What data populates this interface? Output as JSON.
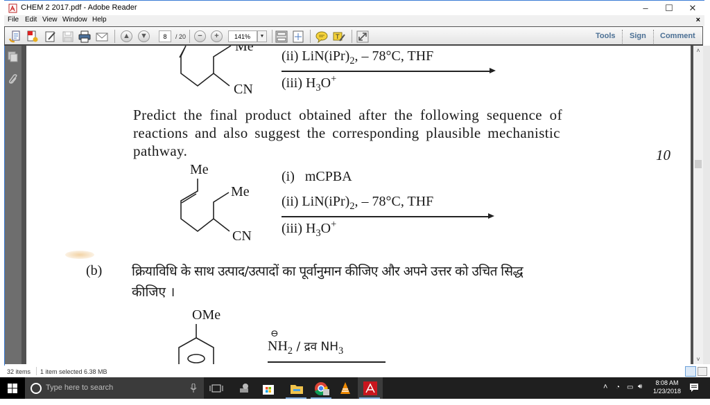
{
  "window": {
    "title": "CHEM 2 2017.pdf - Adobe Reader",
    "controls": {
      "minimize": "–",
      "maximize": "☐",
      "close": "✕"
    }
  },
  "menubar": {
    "items": [
      "File",
      "Edit",
      "View",
      "Window",
      "Help"
    ],
    "close_doc": "×"
  },
  "toolbar": {
    "icons": [
      "create-pdf-icon",
      "export-pdf-icon",
      "edit-icon",
      "save-icon",
      "print-icon",
      "email-icon"
    ],
    "prev_page": "▲",
    "next_page": "▼",
    "current_page": "8",
    "total_pages": "/ 20",
    "zoom_out": "−",
    "zoom_in": "+",
    "zoom_level": "141%",
    "zoom_dropdown": "▼",
    "right_tabs": [
      "Tools",
      "Sign",
      "Comment"
    ]
  },
  "document": {
    "top_reaction": {
      "me_label": "Me",
      "cn_label": "CN",
      "step_ii": "(ii)  LiN(iPr)",
      "step_ii_sub": "2",
      "step_ii_tail": ", – 78°C, THF",
      "step_iii": "(iii) H",
      "step_iii_sub": "3",
      "step_iii_o": "O",
      "step_iii_sup": "+"
    },
    "question_text_line1": "Predict the final product obtained after the following sequence of",
    "question_text_line2": "reactions and also suggest the corresponding plausible mechanistic",
    "question_text_line3": "pathway.",
    "marks": "10",
    "reaction": {
      "me_top": "Me",
      "me_right": "Me",
      "cn": "CN",
      "step_i": "(i)   mCPBA",
      "step_ii": "(ii)  LiN(iPr)",
      "step_ii_sub": "2",
      "step_ii_tail": ", – 78°C, THF",
      "step_iii": "(iii) H",
      "step_iii_sub": "3",
      "step_iii_o": "O",
      "step_iii_sup": "+"
    },
    "part_b": {
      "label": "(b)",
      "hindi_line1": "क्रियाविधि के साथ उत्पाद/उत्पादों का पूर्वानुमान कीजिए और अपने उत्तर को उचित सिद्ध",
      "hindi_line2": "कीजिए ।",
      "substituent": "OMe",
      "reagent_charge": "⊖",
      "reagent_n": "N",
      "reagent_h": "H",
      "reagent_sub": "2",
      "reagent_tail": " / द्रव NH",
      "reagent_sub2": "3"
    }
  },
  "statusbar": {
    "items_count": "32 items",
    "selection": "1 item selected  6.38 MB"
  },
  "taskbar": {
    "search_placeholder": "Type here to search",
    "apps": [
      "task-view",
      "network-app",
      "store",
      "file-explorer",
      "chrome",
      "vlc",
      "adobe-reader"
    ],
    "time": "8:08 AM",
    "date": "1/23/2018"
  },
  "colors": {
    "tab_text": "#4a6f94",
    "taskbar_bg": "#1f1f1f",
    "accent_blue": "#3a7bd5",
    "sidebar_bg": "#6e6e6e"
  }
}
